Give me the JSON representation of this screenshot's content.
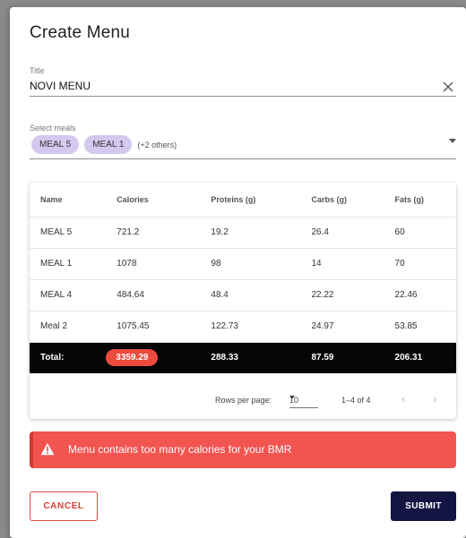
{
  "dialog": {
    "title": "Create Menu"
  },
  "title_field": {
    "label": "Title",
    "value": "NOVI MENU"
  },
  "meals_field": {
    "label": "Select meals",
    "chips": [
      "MEAL 5",
      "MEAL 1"
    ],
    "more": "(+2 others)"
  },
  "table": {
    "headers": [
      "Name",
      "Calories",
      "Proteins (g)",
      "Carbs (g)",
      "Fats (g)"
    ],
    "rows": [
      [
        "MEAL 5",
        "721.2",
        "19.2",
        "26.4",
        "60"
      ],
      [
        "MEAL 1",
        "1078",
        "98",
        "14",
        "70"
      ],
      [
        "MEAL 4",
        "484.64",
        "48.4",
        "22.22",
        "22.46"
      ],
      [
        "Meal 2",
        "1075.45",
        "122.73",
        "24.97",
        "53.85"
      ]
    ],
    "total": {
      "label": "Total:",
      "calories": "3359.29",
      "proteins": "288.33",
      "carbs": "87.59",
      "fats": "206.31"
    }
  },
  "pagination": {
    "rows_per_page_label": "Rows per page:",
    "rows_per_page": "10",
    "range": "1–4 of 4",
    "prev_icon": "chevron-left-icon",
    "next_icon": "chevron-right-icon"
  },
  "alert": {
    "icon": "warning-icon",
    "message": "Menu contains too many calories for your BMR"
  },
  "actions": {
    "cancel_label": "CANCEL",
    "submit_label": "SUBMIT"
  },
  "colors": {
    "chip_bg": "#d4c8ee",
    "alert_bg": "#f25450",
    "calories_badge": "#ec4a3f",
    "cancel_accent": "#d84138",
    "submit_bg": "#141443",
    "total_row_bg": "#050505"
  }
}
